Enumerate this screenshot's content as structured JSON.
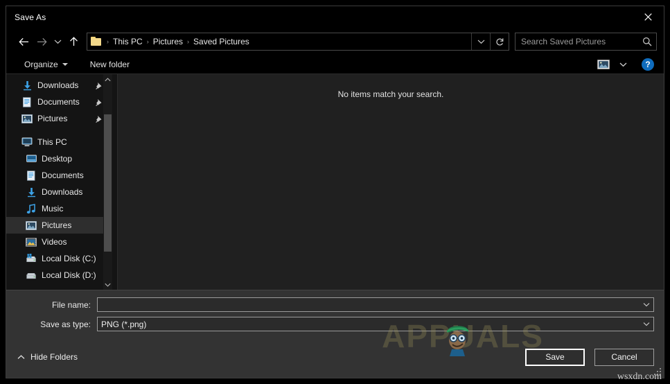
{
  "window": {
    "title": "Save As",
    "close_icon": "close-icon"
  },
  "navbar": {
    "back_icon": "arrow-left-icon",
    "forward_icon": "arrow-right-icon",
    "recent_icon": "chevron-down-icon",
    "up_icon": "arrow-up-icon",
    "folder_icon": "folder-icon",
    "breadcrumbs": [
      "This PC",
      "Pictures",
      "Saved Pictures"
    ],
    "separator": "›",
    "dropdown_icon": "chevron-down-icon",
    "refresh_icon": "refresh-icon"
  },
  "search": {
    "placeholder": "Search Saved Pictures",
    "value": "",
    "icon": "search-icon"
  },
  "commandbar": {
    "organize_label": "Organize",
    "new_folder_label": "New folder",
    "view_icon": "picture-view-icon",
    "view_dropdown_icon": "chevron-down-icon",
    "help_label": "?",
    "help_icon": "help-icon"
  },
  "navpane": {
    "items": [
      {
        "label": "Downloads",
        "icon": "download-icon",
        "level": 1,
        "pinned": true,
        "selected": false
      },
      {
        "label": "Documents",
        "icon": "document-icon",
        "level": 1,
        "pinned": true,
        "selected": false
      },
      {
        "label": "Pictures",
        "icon": "picture-icon",
        "level": 1,
        "pinned": true,
        "selected": false
      },
      {
        "label": "This PC",
        "icon": "pc-icon",
        "level": 1,
        "pinned": false,
        "selected": false,
        "gap_before": true
      },
      {
        "label": "Desktop",
        "icon": "desktop-icon",
        "level": 2,
        "pinned": false,
        "selected": false
      },
      {
        "label": "Documents",
        "icon": "document-icon",
        "level": 2,
        "pinned": false,
        "selected": false
      },
      {
        "label": "Downloads",
        "icon": "download-icon",
        "level": 2,
        "pinned": false,
        "selected": false
      },
      {
        "label": "Music",
        "icon": "music-icon",
        "level": 2,
        "pinned": false,
        "selected": false
      },
      {
        "label": "Pictures",
        "icon": "picture-icon",
        "level": 2,
        "pinned": false,
        "selected": true
      },
      {
        "label": "Videos",
        "icon": "video-icon",
        "level": 2,
        "pinned": false,
        "selected": false
      },
      {
        "label": "Local Disk (C:)",
        "icon": "system-drive-icon",
        "level": 2,
        "pinned": false,
        "selected": false
      },
      {
        "label": "Local Disk (D:)",
        "icon": "drive-icon",
        "level": 2,
        "pinned": false,
        "selected": false
      }
    ],
    "scroll_up_icon": "chevron-up-icon",
    "scroll_down_icon": "chevron-down-icon"
  },
  "filelist": {
    "empty_message": "No items match your search."
  },
  "form": {
    "filename_label": "File name:",
    "filename_value": "",
    "filetype_label": "Save as type:",
    "filetype_value": "PNG (*.png)",
    "dropdown_icon": "chevron-down-icon"
  },
  "footer": {
    "hide_folders_label": "Hide Folders",
    "hide_folders_icon": "chevron-up-icon",
    "save_label": "Save",
    "cancel_label": "Cancel",
    "resize_grip_icon": "resize-grip-icon"
  },
  "watermarks": {
    "brand": "APPUALS",
    "site": "wsxdn.com"
  },
  "colors": {
    "accent": "#0f6cbd",
    "window_bg": "#000000",
    "pane_bg": "#141414",
    "list_bg": "#202020",
    "form_bg": "#333333",
    "folder_yellow": "#f3d88a"
  }
}
